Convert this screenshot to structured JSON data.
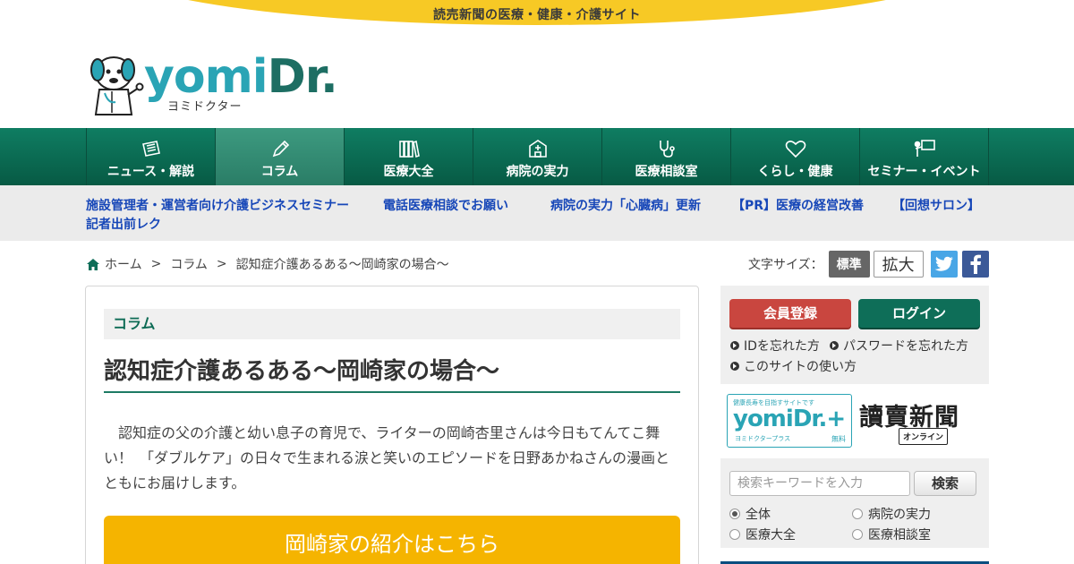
{
  "site": {
    "tagline": "読売新聞の医療・健康・介護サイト",
    "logo_yomi": "yomi",
    "logo_dr": "Dr.",
    "logo_kana": "ヨミドクター"
  },
  "nav": {
    "items": [
      {
        "label": "ニュース・解説",
        "icon": "newspaper-icon"
      },
      {
        "label": "コラム",
        "icon": "pencil-icon",
        "active": true
      },
      {
        "label": "医療大全",
        "icon": "books-icon"
      },
      {
        "label": "病院の実力",
        "icon": "hospital-icon"
      },
      {
        "label": "医療相談室",
        "icon": "stethoscope-icon"
      },
      {
        "label": "くらし・健康",
        "icon": "heart-icon"
      },
      {
        "label": "セミナー・イベント",
        "icon": "presenter-icon"
      }
    ]
  },
  "sublinks": [
    "施設管理者・運営者向け介護ビジネスセミナー",
    "電話医療相談でお願い",
    "病院の実力「心臓病」更新",
    "【PR】医療の経営改善",
    "【回想サロン】",
    "記者出前レク"
  ],
  "breadcrumb": {
    "home": "ホーム",
    "sep": ">",
    "level1": "コラム",
    "current": "認知症介護あるある～岡崎家の場合～"
  },
  "font_size": {
    "label": "文字サイズ：",
    "standard": "標準",
    "large": "拡大"
  },
  "article": {
    "category": "コラム",
    "title": "認知症介護あるある～岡崎家の場合～",
    "lead": "認知症の父の介護と幼い息子の育児で、ライターの岡崎杏里さんは今日もてんてこ舞い！　「ダブルケア」の日々で生まれる涙と笑いのエピソードを日野あかねさんの漫画とともにお届けします。",
    "intro_button": "岡崎家の紹介はこちら"
  },
  "sidebar": {
    "register": "会員登録",
    "login": "ログイン",
    "forgot_id": "IDを忘れた方",
    "forgot_password": "パスワードを忘れた方",
    "how_to_use": "このサイトの使い方",
    "plus_banner": {
      "top": "健康長寿を目指すサイトです",
      "word": "yomiDr.+",
      "bottom": "ヨミドクタープラス",
      "free": "無料"
    },
    "yomiuri_banner": {
      "name": "讀賣新聞",
      "online": "オンライン"
    },
    "search": {
      "placeholder": "検索キーワードを入力",
      "button": "検索",
      "options": [
        "全体",
        "病院の実力",
        "医療大全",
        "医療相談室"
      ],
      "selected": "全体"
    }
  },
  "colors": {
    "brand_green": "#0e6e58",
    "brand_yellow": "#f7c925",
    "link_blue": "#1747b8",
    "register_red": "#c9463f",
    "intro_orange": "#f5b400"
  }
}
